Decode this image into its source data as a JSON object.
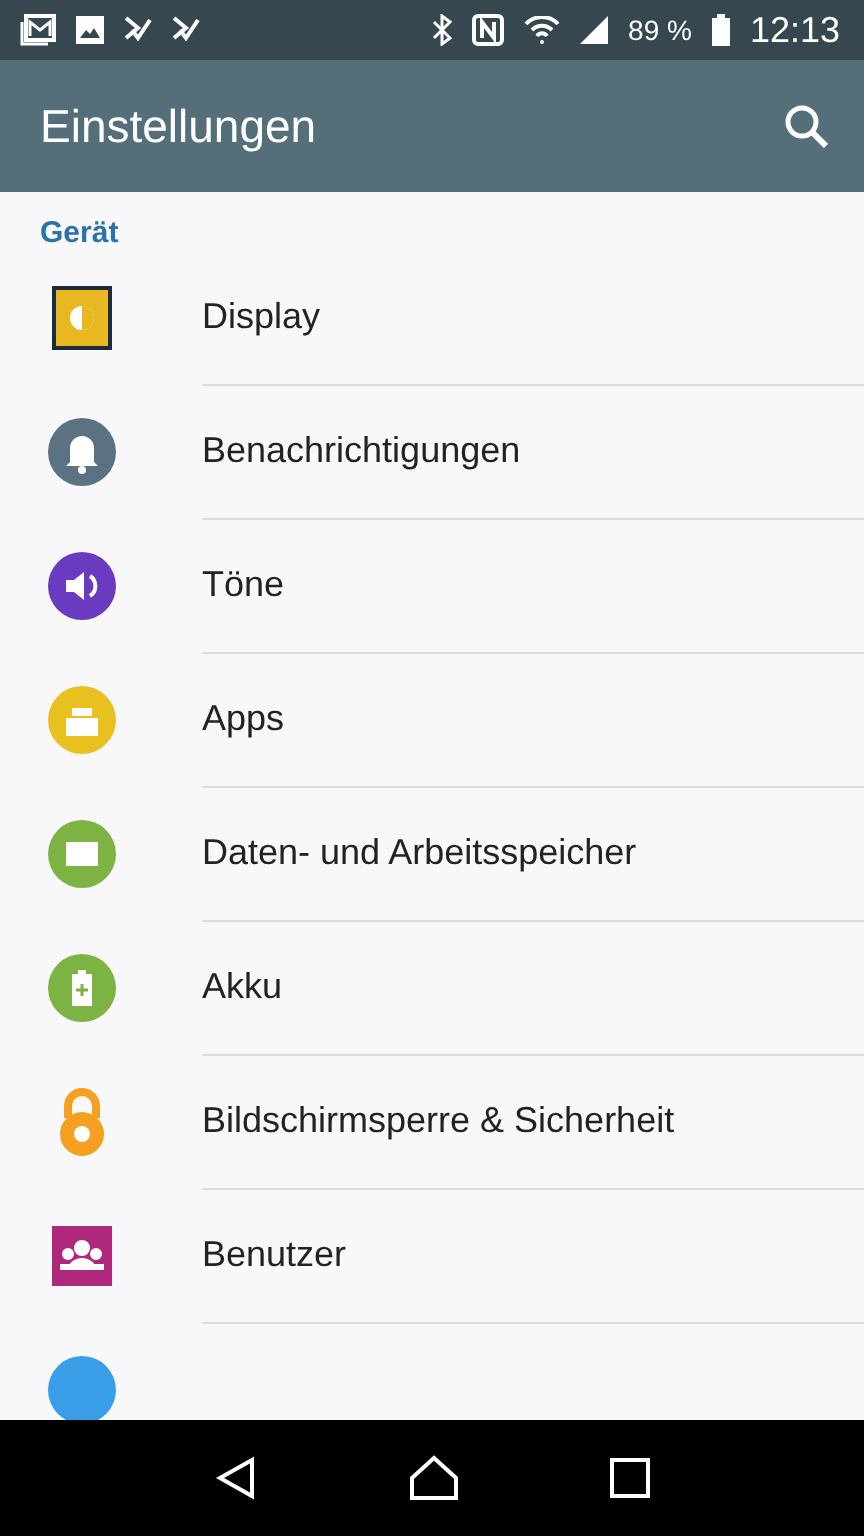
{
  "status_bar": {
    "battery": "89 %",
    "time": "12:13"
  },
  "app_bar": {
    "title": "Einstellungen"
  },
  "section": {
    "title": "Gerät"
  },
  "items": [
    {
      "label": "Display"
    },
    {
      "label": "Benachrichtigungen"
    },
    {
      "label": "Töne"
    },
    {
      "label": "Apps"
    },
    {
      "label": "Daten- und Arbeitsspeicher"
    },
    {
      "label": "Akku"
    },
    {
      "label": "Bildschirmsperre & Sicherheit"
    },
    {
      "label": "Benutzer"
    }
  ]
}
